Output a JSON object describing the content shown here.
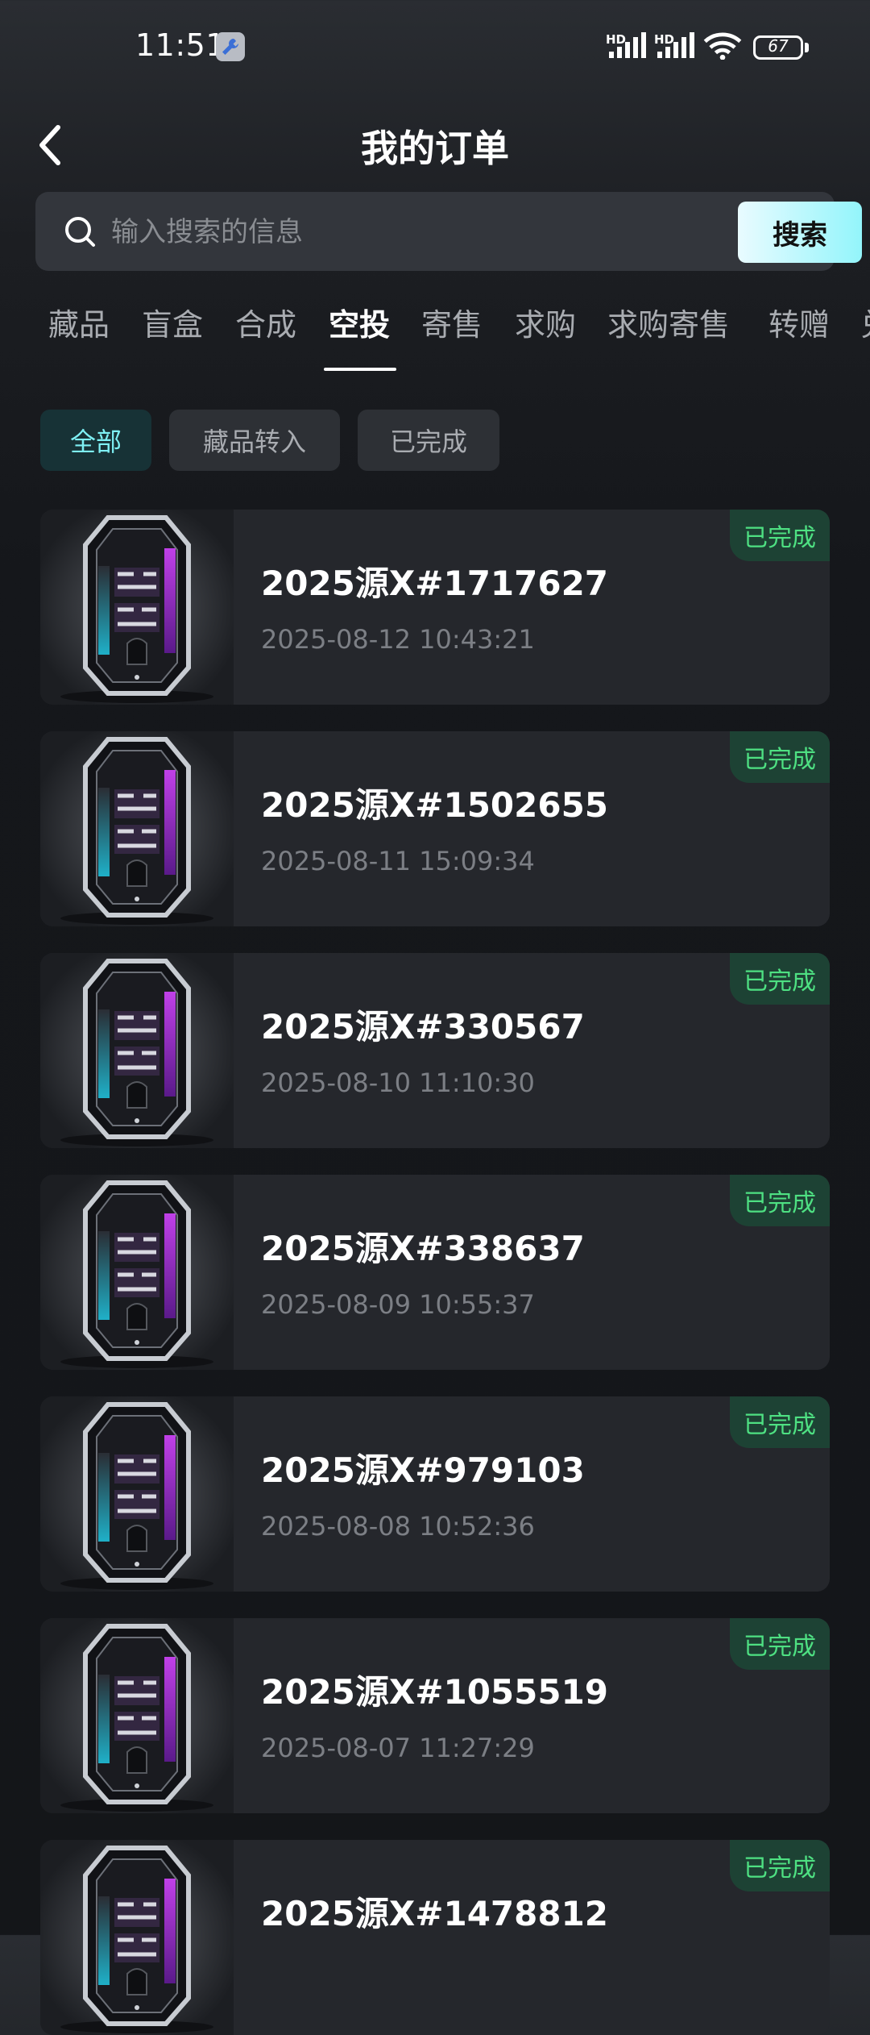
{
  "status_bar": {
    "time": "11:51",
    "battery": "67",
    "hd_label": "HD"
  },
  "header": {
    "title": "我的订单"
  },
  "search": {
    "placeholder": "输入搜索的信息",
    "button_label": "搜索"
  },
  "tabs": [
    {
      "label": "藏品"
    },
    {
      "label": "盲盒"
    },
    {
      "label": "合成"
    },
    {
      "label": "空投",
      "active": true
    },
    {
      "label": "寄售"
    },
    {
      "label": "求购"
    },
    {
      "label": "求购寄售"
    },
    {
      "label": "转赠"
    },
    {
      "label": "兑"
    }
  ],
  "filters": [
    {
      "label": "全部",
      "active": true
    },
    {
      "label": "藏品转入"
    },
    {
      "label": "已完成"
    }
  ],
  "orders": [
    {
      "title": "2025源X#1717627",
      "time": "2025-08-12 10:43:21",
      "status": "已完成"
    },
    {
      "title": "2025源X#1502655",
      "time": "2025-08-11 15:09:34",
      "status": "已完成"
    },
    {
      "title": "2025源X#330567",
      "time": "2025-08-10 11:10:30",
      "status": "已完成"
    },
    {
      "title": "2025源X#338637",
      "time": "2025-08-09 10:55:37",
      "status": "已完成"
    },
    {
      "title": "2025源X#979103",
      "time": "2025-08-08 10:52:36",
      "status": "已完成"
    },
    {
      "title": "2025源X#1055519",
      "time": "2025-08-07 11:27:29",
      "status": "已完成"
    },
    {
      "title": "2025源X#1478812",
      "time": "",
      "status": "已完成"
    }
  ],
  "colors": {
    "accent": "#7ef0f4",
    "status_green": "#4ee082",
    "background": "#15171b"
  }
}
